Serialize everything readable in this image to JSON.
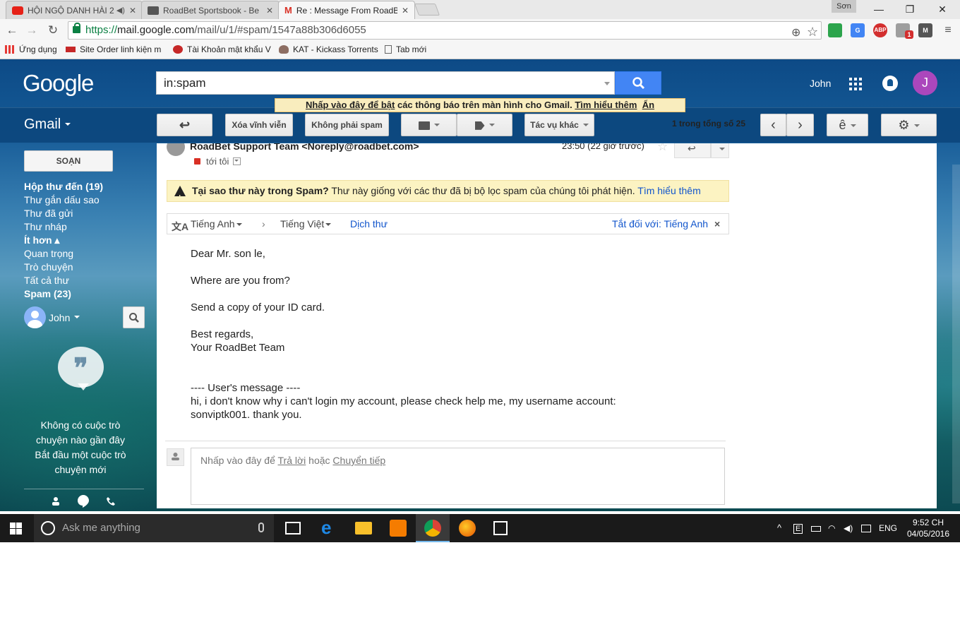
{
  "browser": {
    "tabs": [
      {
        "title": "HỘI NGỘ DANH HÀI 2",
        "icon": "youtube-icon",
        "active": false
      },
      {
        "title": "RoadBet Sportsbook - Be",
        "icon": "roadbet-icon",
        "active": false
      },
      {
        "title": "Re : Message From RoadB",
        "icon": "gmail-icon",
        "active": true
      }
    ],
    "user_label": "Sơn",
    "window_controls": {
      "minimize": "—",
      "restore": "❐",
      "close": "✕"
    },
    "url": {
      "scheme": "https://",
      "host": "mail.google.com",
      "path": "/mail/u/1/#spam/1547a88b306d6055"
    },
    "bookmarks": [
      {
        "label": "Ứng dụng",
        "icon": "apps-icon"
      },
      {
        "label": "Site Order linh kiện m",
        "icon": "site-icon"
      },
      {
        "label": "Tài Khoản mật khẩu V",
        "icon": "bookmark-icon"
      },
      {
        "label": "KAT - Kickass Torrents",
        "icon": "kat-icon"
      },
      {
        "label": "Tab mới",
        "icon": "page-icon"
      }
    ],
    "extensions": {
      "abp": "ABP",
      "badge": "1"
    }
  },
  "gmail": {
    "logo": "Google",
    "search_value": "in:spam",
    "user_name": "John",
    "avatar_letter": "J",
    "notice": {
      "enable": "Nhấp vào đây để bật",
      "middle": " các thông báo trên màn hình cho Gmail.  ",
      "learn_more": "Tìm hiểu thêm",
      "hide": "Ẩn"
    },
    "app_label": "Gmail",
    "toolbar": {
      "delete_forever": "Xóa vĩnh viễn",
      "not_spam": "Không phải spam",
      "more_actions": "Tác vụ khác",
      "pager": "1 trong tổng số 25",
      "input_tool": "ê"
    },
    "compose": "SOẠN",
    "nav": [
      {
        "label": "Hộp thư đến (19)",
        "bold": true
      },
      {
        "label": "Thư gắn dấu sao",
        "bold": false
      },
      {
        "label": "Thư đã gửi",
        "bold": false
      },
      {
        "label": "Thư nháp",
        "bold": false
      },
      {
        "label": "Ít hơn ▴",
        "bold": true
      },
      {
        "label": "Quan trọng",
        "bold": false
      },
      {
        "label": "Trò chuyện",
        "bold": false
      },
      {
        "label": "Tất cả thư",
        "bold": false
      },
      {
        "label": "Spam (23)",
        "bold": true
      }
    ],
    "chat": {
      "user": "John",
      "empty_line1": "Không có cuộc trò chuyện nào gần đây",
      "empty_line2": "Bắt đầu một cuộc trò chuyện mới"
    },
    "message": {
      "sender": "RoadBet Support Team <Noreply@roadbet.com>",
      "time": "23:50 (22 giờ trước)",
      "to": "tới tôi",
      "spam_warning": {
        "title": "Tại sao thư này trong Spam?",
        "text": " Thư này giống với các thư đã bị bộ lọc spam của chúng tôi phát hiện. ",
        "link": "Tìm hiểu thêm"
      },
      "translate": {
        "from": "Tiếng Anh",
        "to": "Tiếng Việt",
        "action": "Dịch thư",
        "off": "Tắt đối với: Tiếng Anh"
      },
      "body": {
        "greeting": "Dear Mr. son le,",
        "line1": "Where are you from?",
        "line2": "Send a copy of your ID card.",
        "sign1": "Best regards,",
        "sign2": "Your RoadBet Team",
        "quote_header": "---- User's message ----",
        "quote1": "hi, i don't know why i can't login my account, please check help me, my username account:",
        "quote2": "sonviptk001. thank you."
      },
      "reply": {
        "prefix": "Nhấp vào đây để ",
        "reply": "Trả lời",
        "or": " hoặc ",
        "forward": "Chuyển tiếp"
      }
    }
  },
  "taskbar": {
    "search_placeholder": "Ask me anything",
    "lang": "ENG",
    "time": "9:52 CH",
    "date": "04/05/2016"
  }
}
